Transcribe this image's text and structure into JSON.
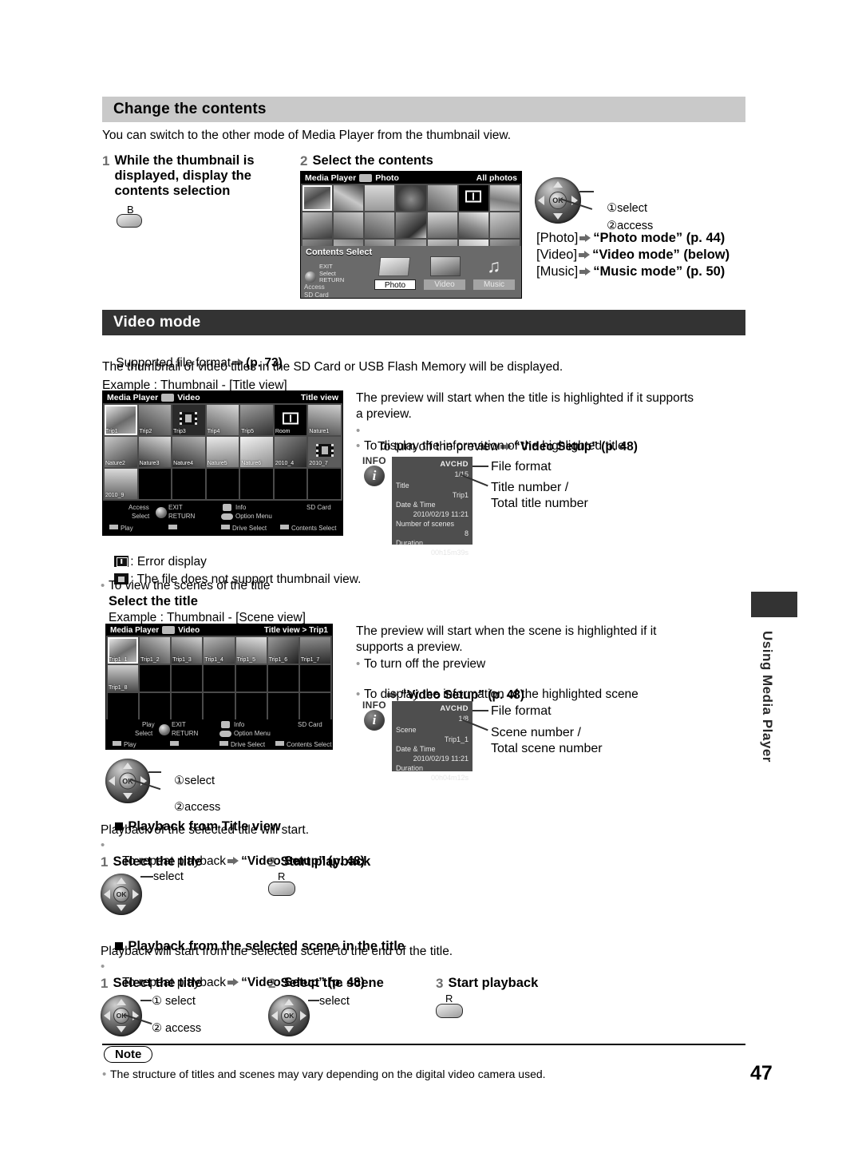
{
  "page_number": "47",
  "side_tab_label": "Using Media Player",
  "section1": {
    "header": "Change the contents",
    "intro": "You can switch to the other mode of Media Player from the thumbnail view.",
    "step1": {
      "num": "1",
      "label_line1": "While the thumbnail is",
      "label_line2": "displayed, display the",
      "label_line3": "contents selection",
      "key_label": "B"
    },
    "step2": {
      "num": "2",
      "label": "Select the contents",
      "dpad": {
        "select": "select",
        "access": "access",
        "ok": "OK",
        "n1": "①",
        "n2": "②"
      },
      "modes": [
        {
          "bracket": "[Photo]",
          "target": "“Photo mode” (p. 44)"
        },
        {
          "bracket": "[Video]",
          "target": "“Video mode” (below)"
        },
        {
          "bracket": "[Music]",
          "target": "“Music mode” (p. 50)"
        }
      ]
    },
    "screen": {
      "title": "Media Player",
      "mode": "Photo",
      "corner": "All photos",
      "overlay_title": "Contents Select",
      "guide": [
        "EXIT",
        "Select",
        "RETURN"
      ],
      "access": "Access",
      "drive": "SD Card",
      "tabs": [
        "Photo",
        "Video",
        "Music"
      ]
    }
  },
  "section2": {
    "header": "Video mode",
    "supported_prefix": "Supported file format",
    "supported_page": "(p. 73)",
    "intro": "The thumbnail of video titles in the SD Card or USB Flash Memory will be displayed.",
    "example_title": "Example : Thumbnail - [Title view]",
    "preview_note_line1": "The preview will start when the title is highlighted if it supports",
    "preview_note_line2": "a preview.",
    "bullet_turn_off": "To turn off the preview",
    "bullet_turn_off_target": "“Video Setup” (p. 48)",
    "bullet_info": "To display the information of the highlighted title",
    "legend_error": ": Error display",
    "legend_nosupport": ": The file does not support thumbnail view.",
    "bullet_view_scenes": "To view the scenes of the title",
    "select_the_title": "Select the title",
    "example_scene": "Example : Thumbnail - [Scene view]",
    "title_screen": {
      "title": "Media Player",
      "mode": "Video",
      "corner": "Title view",
      "thumbs_row1": [
        "Trip1",
        "Trip2",
        "Trip3",
        "Trip4",
        "Trip5",
        "Room",
        "Nature1"
      ],
      "thumbs_row2": [
        "Nature2",
        "Nature3",
        "Nature4",
        "Nature5",
        "Nature6",
        "2010_4",
        "2010_7"
      ],
      "thumbs_row3": [
        "2010_9",
        "",
        "",
        "",
        "",
        "",
        ""
      ],
      "foot": {
        "access": "Access",
        "select": "Select",
        "exit": "EXIT",
        "return": "RETURN",
        "info": "Info",
        "option": "Option Menu",
        "drive_label": "SD Card",
        "play": "Play",
        "drive_select": "Drive Select",
        "contents_select": "Contents Select"
      }
    },
    "scene_screen": {
      "title": "Media Player",
      "mode": "Video",
      "corner": "Title view  >  Trip1",
      "thumbs_row1": [
        "Trip1_1",
        "Trip1_2",
        "Trip1_3",
        "Trip1_4",
        "Trip1_5",
        "Trip1_6",
        "Trip1_7"
      ],
      "thumbs_row2": [
        "Trip1_8",
        "",
        "",
        "",
        "",
        "",
        ""
      ],
      "foot": {
        "play_lbl": "Play",
        "select": "Select",
        "exit": "EXIT",
        "return": "RETURN",
        "info": "Info",
        "option": "Option Menu",
        "drive_label": "SD Card",
        "play": "Play",
        "drive_select": "Drive Select",
        "contents_select": "Contents Select"
      }
    },
    "info_title": {
      "badge": "INFO",
      "format": "AVCHD",
      "counter": "1/15",
      "rows": [
        {
          "label": "Title",
          "value": "Trip1"
        },
        {
          "label": "Date & Time",
          "value": "2010/02/19 11:21"
        },
        {
          "label": "Number of scenes",
          "value": "8"
        },
        {
          "label": "Duration",
          "value": "00h15m39s"
        }
      ],
      "callout_format": "File format",
      "callout_num_line1": "Title number /",
      "callout_num_line2": "Total title number"
    },
    "info_scene": {
      "badge": "INFO",
      "format": "AVCHD",
      "counter": "1/8",
      "rows": [
        {
          "label": "Scene",
          "value": "Trip1_1"
        },
        {
          "label": "Date & Time",
          "value": "2010/02/19 11:21"
        },
        {
          "label": "Duration",
          "value": "00h04m12s"
        }
      ],
      "callout_format": "File format",
      "callout_num_line1": "Scene number /",
      "callout_num_line2": "Total scene number"
    },
    "scene_preview_line1": "The preview will start when the scene is highlighted if it",
    "scene_preview_line2": "supports a preview.",
    "scene_bullet_turn_off": "To turn off the preview",
    "scene_bullet_turn_off_target": "“Video Setup” (p. 48)",
    "scene_bullet_info": "To display the information of the highlighted scene",
    "dpad_scene": {
      "select": "select",
      "access": "access",
      "ok": "OK",
      "n1": "①",
      "n2": "②"
    }
  },
  "playback_title": {
    "heading": "Playback from Title view",
    "desc": "Playback of the selected title will start.",
    "bullet_repeat": "To repeat playback",
    "bullet_repeat_target": "“Video Setup” (p. 48)",
    "steps": [
      {
        "num": "1",
        "label": "Select the title",
        "hint": "select"
      },
      {
        "num": "2",
        "label": "Start playback",
        "key": "R"
      }
    ],
    "ok": "OK"
  },
  "playback_scene": {
    "heading": "Playback from the selected scene in the title",
    "desc": "Playback will start from the selected scene to the end of the title.",
    "bullet_repeat": "To repeat playback",
    "bullet_repeat_target": "“Video Setup” (p. 48)",
    "steps": [
      {
        "num": "1",
        "label": "Select the title",
        "hint1": "① select",
        "hint2": "② access"
      },
      {
        "num": "2",
        "label": "Select the scene",
        "hint1": "select"
      },
      {
        "num": "3",
        "label": "Start playback",
        "key": "R"
      }
    ],
    "ok": "OK"
  },
  "note": {
    "badge": "Note",
    "item": "The structure of titles and scenes may vary depending on the digital video camera used."
  }
}
